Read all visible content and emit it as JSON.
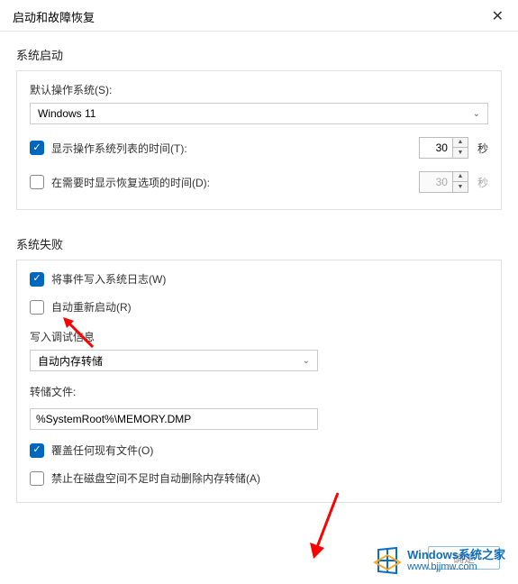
{
  "dialog": {
    "title": "启动和故障恢复",
    "close": "✕"
  },
  "startup": {
    "section": "系统启动",
    "default_os_label": "默认操作系统(S):",
    "default_os_value": "Windows 11",
    "show_os_list_label": "显示操作系统列表的时间(T):",
    "show_os_list_checked": true,
    "show_os_list_value": "30",
    "show_os_list_unit": "秒",
    "show_recovery_label": "在需要时显示恢复选项的时间(D):",
    "show_recovery_checked": false,
    "show_recovery_value": "30",
    "show_recovery_unit": "秒"
  },
  "failure": {
    "section": "系统失败",
    "write_event_label": "将事件写入系统日志(W)",
    "write_event_checked": true,
    "auto_restart_label": "自动重新启动(R)",
    "auto_restart_checked": false,
    "debug_info_label": "写入调试信息",
    "debug_select_value": "自动内存转储",
    "dump_file_label": "转储文件:",
    "dump_file_value": "%SystemRoot%\\MEMORY.DMP",
    "overwrite_label": "覆盖任何现有文件(O)",
    "overwrite_checked": true,
    "disable_auto_delete_label": "禁止在磁盘空间不足时自动删除内存转储(A)",
    "disable_auto_delete_checked": false
  },
  "buttons": {
    "ok": "确定"
  },
  "watermark": {
    "title": "Windows系统之家",
    "url": "www.bjjmw.com"
  }
}
